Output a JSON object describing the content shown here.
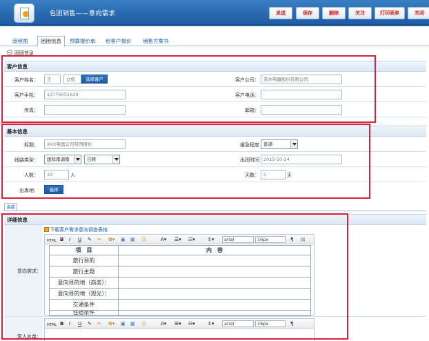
{
  "header": {
    "title": "包团销售——意向需求",
    "buttons": {
      "send": "发送",
      "save": "保存",
      "delete": "删除",
      "follow": "关注",
      "print": "打印表单",
      "close": "关闭"
    }
  },
  "tabs": [
    "流程图",
    "团团信息",
    "预算报价单",
    "给客户报价",
    "销售方案书"
  ],
  "subhead": "团团信息",
  "customer": {
    "section_title": "客户信息",
    "name_label": "客户姓名：",
    "surname": "王",
    "given_name": "立权",
    "choose_btn": "选择客户",
    "company_label": "客户公司：",
    "company": "苏州电器股份有限公司",
    "mobile_label": "客户手机：",
    "mobile": "13776051619",
    "phone_label": "客户电话：",
    "phone": "",
    "fax_label": "传真：",
    "fax": "",
    "email_label": "邮箱：",
    "email": ""
  },
  "basic": {
    "section_title": "基本信息",
    "title_label": "标题：",
    "title_value": "XXX电器公司包团报价",
    "urgency_label": "缓急程度",
    "urgency_value": "普通",
    "route_label": "线路类型：",
    "route_value": "国际南调南",
    "route_sub": "日韩",
    "depart_time_label": "出团时间",
    "depart_time": "2015-10-24",
    "people_label": "人数：",
    "people": "10",
    "people_unit": "人",
    "days_label": "天数：",
    "days": "5",
    "days_unit": "天",
    "origin_label": "出发地：",
    "origin_btn": "选择"
  },
  "current_tab": "当前",
  "detail": {
    "section_title": "详细信息",
    "download_link": "下载客户需求意向调查表格",
    "intent_label": "意向需求：",
    "guest_label": "客人名单：",
    "toolbar": {
      "html": "HTML",
      "font": "arial",
      "size": "16px"
    },
    "table_header": [
      "项　目",
      "内　容"
    ],
    "table_rows": [
      "旅行目的",
      "旅行主题",
      "意向目的地（商务）：",
      "意向目的地（观光）：",
      "交通条件",
      "住宿条件"
    ]
  },
  "colors": {
    "header_blue": "#2767ad",
    "annotation_red": "#d8213b",
    "button_blue": "#1a5aa6"
  }
}
